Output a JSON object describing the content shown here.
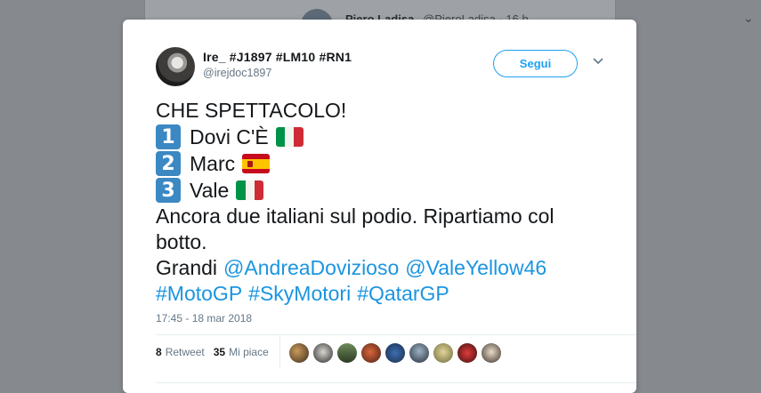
{
  "background_tweet": {
    "name": "Piero Ladisa",
    "handle": "@PieroLadisa · 16 h"
  },
  "user": {
    "display_name": "Ire_ #J1897 #LM10 #RN1",
    "handle": "@irejdoc1897"
  },
  "follow_button": "Segui",
  "tweet": {
    "headline": "CHE SPETTACOLO!",
    "ranking": [
      {
        "position": "1",
        "rider": "Dovi C'È",
        "flag": "italy-flag"
      },
      {
        "position": "2",
        "rider": "Marc",
        "flag": "spain-flag"
      },
      {
        "position": "3",
        "rider": "Vale",
        "flag": "italy-flag"
      }
    ],
    "body_line1": "Ancora due italiani sul podio. Ripartiamo col",
    "body_line2": "botto.",
    "greeting": "Grandi",
    "mention1": "@AndreaDovizioso",
    "mention2": "@ValeYellow46",
    "hashtag1": "#MotoGP",
    "hashtag2": "#SkyMotori",
    "hashtag3": "#QatarGP"
  },
  "timestamp": "17:45 - 18 mar 2018",
  "stats": {
    "retweet_count": "8",
    "retweet_label": "Retweet",
    "like_count": "35",
    "like_label": "Mi piace"
  },
  "colors": {
    "link": "#1b95e0",
    "follow": "#1da1f2",
    "keycap": "#3b88c3"
  },
  "likers_count_shown": 9
}
